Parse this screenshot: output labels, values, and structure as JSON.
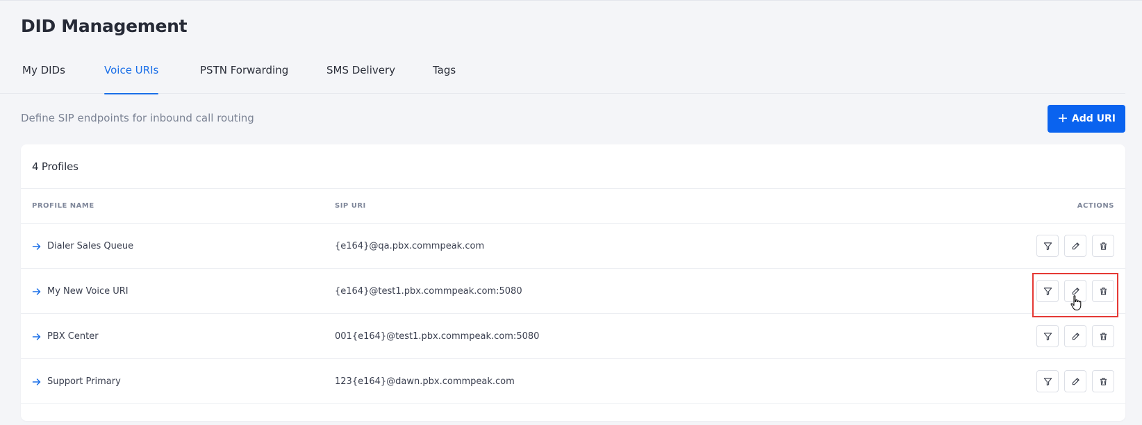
{
  "page": {
    "title": "DID Management",
    "subtitle": "Define SIP endpoints for inbound call routing"
  },
  "tabs": [
    {
      "label": "My DIDs",
      "active": false
    },
    {
      "label": "Voice URIs",
      "active": true
    },
    {
      "label": "PSTN Forwarding",
      "active": false
    },
    {
      "label": "SMS Delivery",
      "active": false
    },
    {
      "label": "Tags",
      "active": false
    }
  ],
  "add_button": {
    "label": "Add URI",
    "icon": "plus-icon"
  },
  "table": {
    "title": "4 Profiles",
    "columns": {
      "profile_name": "PROFILE NAME",
      "sip_uri": "SIP URI",
      "actions": "ACTIONS"
    },
    "rows": [
      {
        "name": "Dialer Sales Queue",
        "uri": "{e164}@qa.pbx.commpeak.com"
      },
      {
        "name": "My New Voice URI",
        "uri": "{e164}@test1.pbx.commpeak.com:5080"
      },
      {
        "name": "PBX Center",
        "uri": "001{e164}@test1.pbx.commpeak.com:5080"
      },
      {
        "name": "Support Primary",
        "uri": "123{e164}@dawn.pbx.commpeak.com"
      }
    ],
    "row_actions": [
      "filter-icon",
      "pencil-icon",
      "trash-icon"
    ]
  },
  "colors": {
    "accent": "#0a63ef",
    "active_tab": "#1a6fe8",
    "highlight": "#e53935",
    "background": "#f4f5f8"
  }
}
